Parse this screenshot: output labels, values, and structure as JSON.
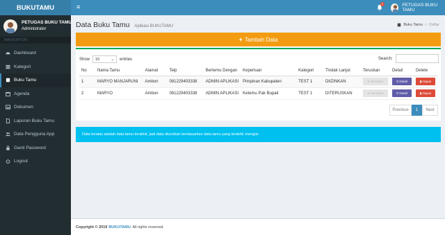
{
  "app": {
    "logo": "BUKUTAMU"
  },
  "topbar": {
    "notification_count": "0",
    "user_label": "PETUGAS BUKU TAMU"
  },
  "sidebar": {
    "user_name": "PETUGAS BUKU TAMU",
    "user_role": "Administrator",
    "nav_header": "NAVIGATION",
    "items": [
      {
        "label": "Dashboard",
        "icon": "dashboard-icon",
        "active": false
      },
      {
        "label": "Kategori",
        "icon": "grid-icon",
        "active": false
      },
      {
        "label": "Buku Tamu",
        "icon": "book-icon",
        "active": true
      },
      {
        "label": "Agenda",
        "icon": "calendar-icon",
        "active": false
      },
      {
        "label": "Dokumen",
        "icon": "image-icon",
        "active": false
      },
      {
        "label": "Laporan Buku Tamu",
        "icon": "document-icon",
        "active": false
      },
      {
        "label": "Data Pengguna App",
        "icon": "users-icon",
        "active": false
      },
      {
        "label": "Ganti Password",
        "icon": "lock-icon",
        "active": false
      },
      {
        "label": "Logout",
        "icon": "power-icon",
        "active": false
      }
    ]
  },
  "header": {
    "title": "Data Buku Tamu",
    "subtitle": "Aplikasi BUKUTAMU",
    "breadcrumb": [
      "Buku Tamu",
      "Daftar"
    ]
  },
  "box": {
    "add_button": "Tambah Data",
    "show_label": "Show",
    "entries_value": "10",
    "entries_label": "entries",
    "search_label": "Search:"
  },
  "table": {
    "columns": [
      "No",
      "Nama Tamu",
      "Alamat",
      "Telp",
      "Bertemu Dengan",
      "Keperluan",
      "Kategori",
      "Tindak Lanjut",
      "Teruskan",
      "Detail",
      "Delete"
    ],
    "rows": [
      {
        "no": "1",
        "nama": "MARYO MANJARUNI",
        "alamat": "Ambon",
        "telp": "081229403338",
        "bertemu": "ADMIN APLIKASI",
        "keperluan": "Pimpinan Kabupaten",
        "kategori": "TEST 1",
        "tindak": "DIIZINKAN"
      },
      {
        "no": "2",
        "nama": "MARYO",
        "alamat": "Ambon",
        "telp": "081229403338",
        "bertemu": "ADMIN APLIKASI",
        "keperluan": "Ketemu Pak Bupati",
        "kategori": "TEST 1",
        "tindak": "DITERUSKAN"
      }
    ],
    "btn_teruskan": "Teruskan",
    "btn_detail": "Detail",
    "btn_hapus": "Hapus"
  },
  "pagination": {
    "prev": "Previous",
    "current": "1",
    "next": "Next"
  },
  "callout": {
    "text": "Data teratas adalah data tamu terakhir, jadi data diurutkan berdasarkan data tamu yang terakhir mengisi."
  },
  "footer": {
    "copyright": "Copyright © 2019",
    "brand": "BUKUTAMU",
    "rest": ". All rights reserved."
  },
  "colors": {
    "primary": "#3c8dbc",
    "sidebar": "#222d32",
    "warning": "#f39c12",
    "info": "#00c0ef",
    "danger": "#dd4b39",
    "purple": "#605ca8"
  }
}
